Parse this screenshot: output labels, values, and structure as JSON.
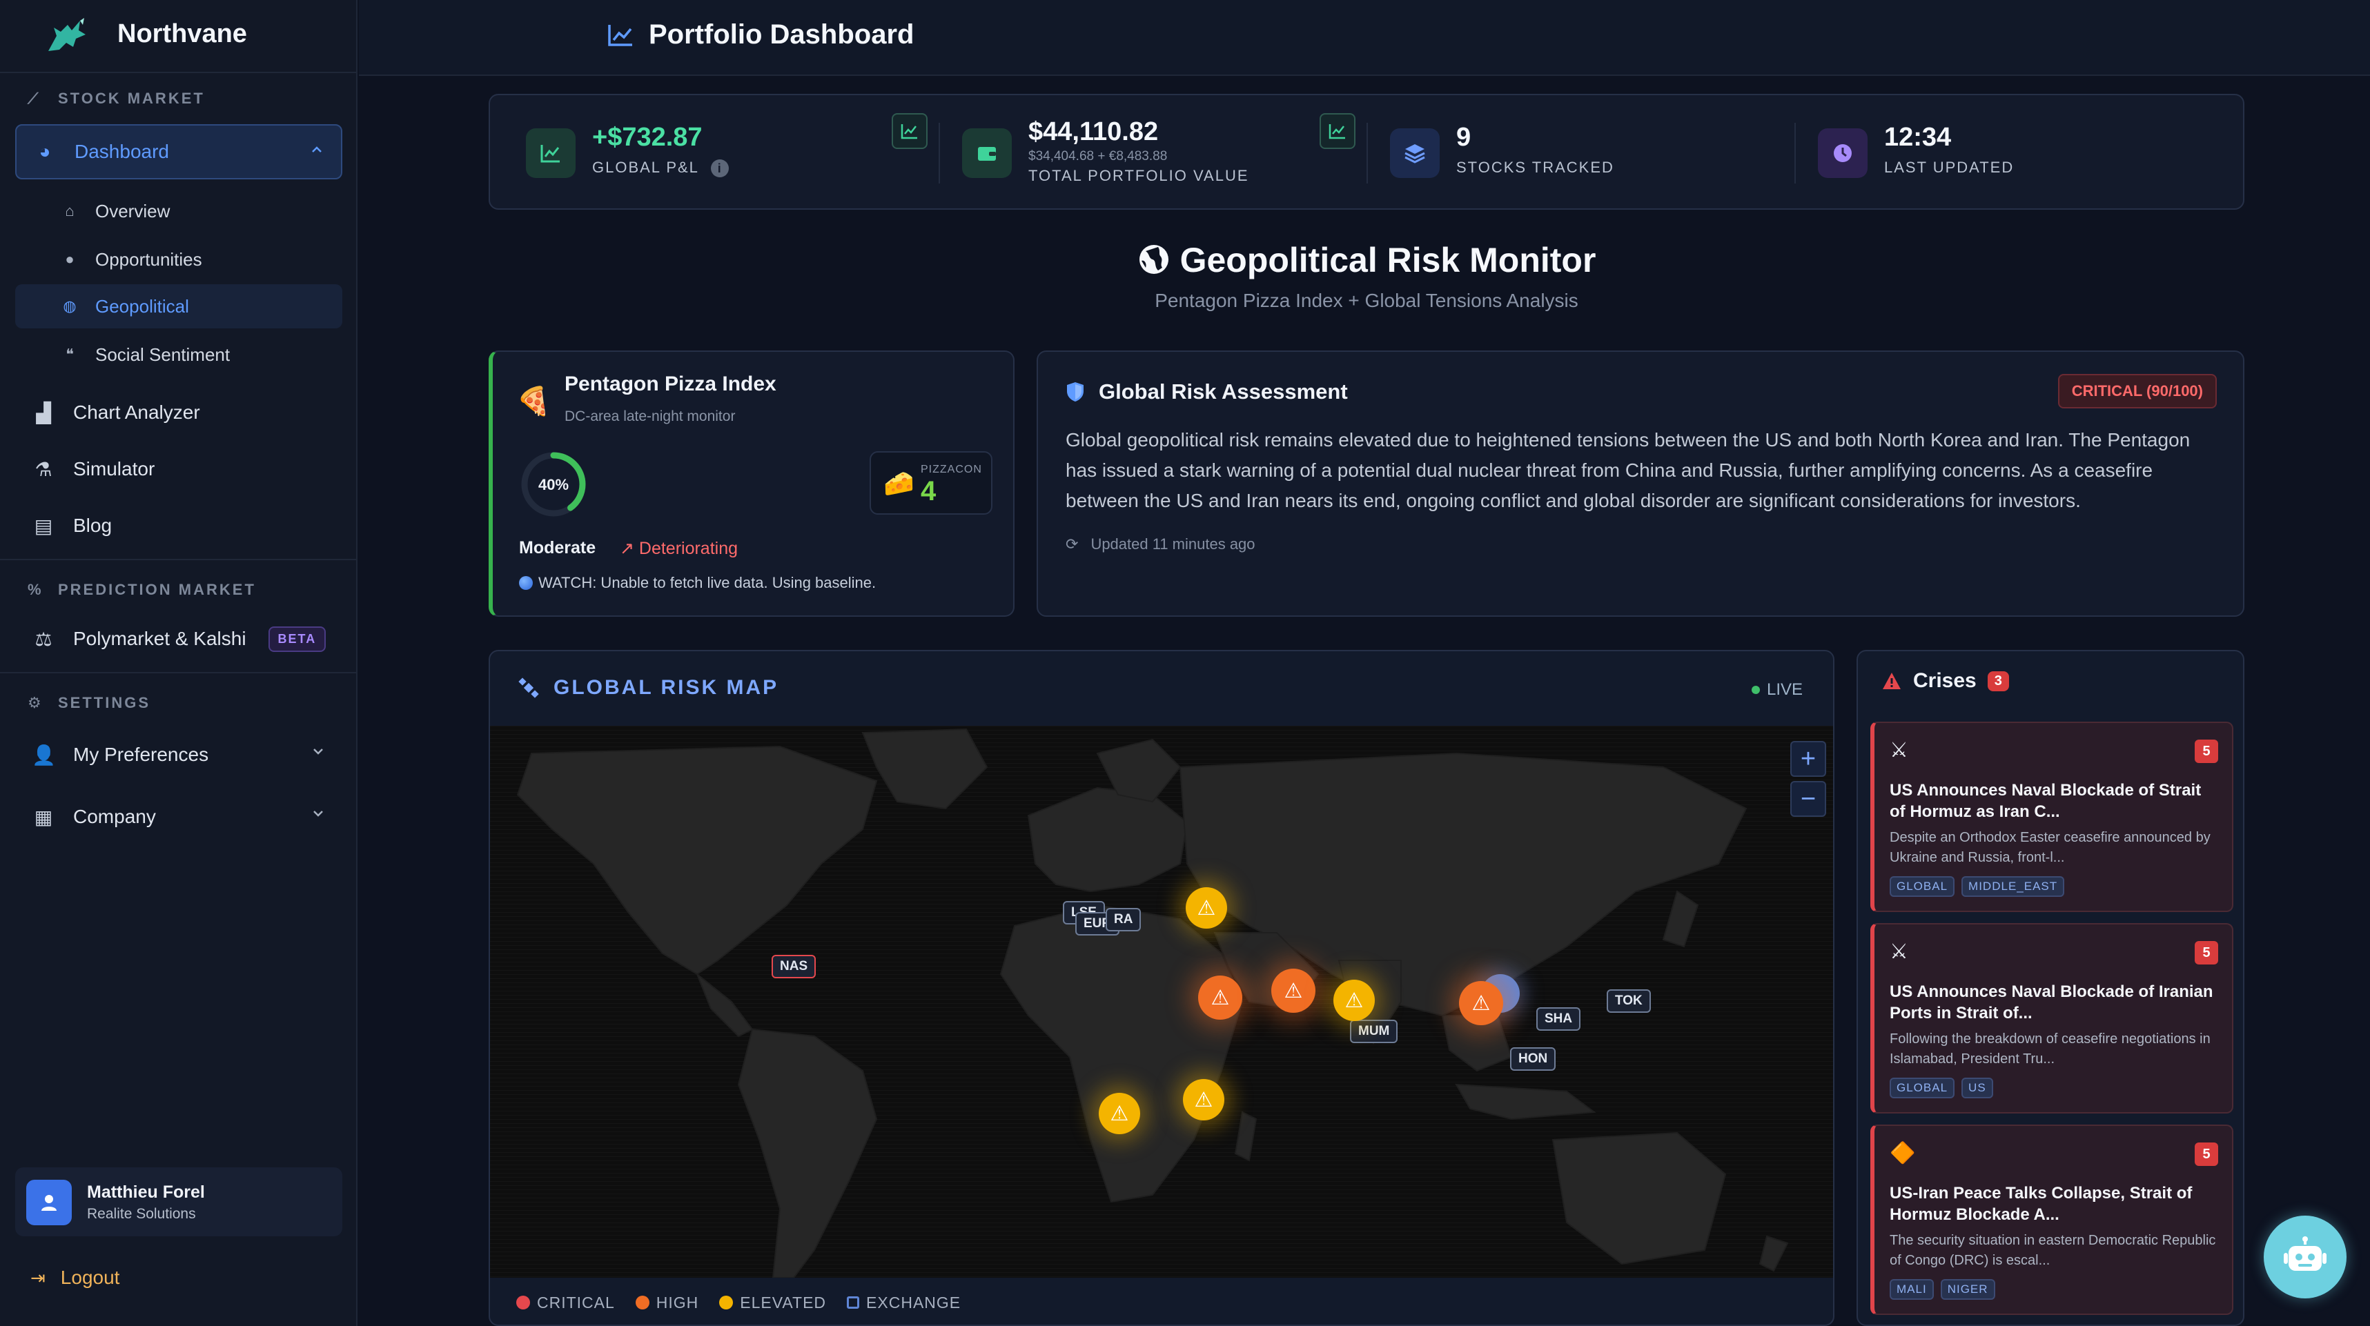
{
  "brand": {
    "name": "Northvane"
  },
  "sidebar": {
    "sections": {
      "stock": "STOCK MARKET",
      "prediction": "PREDICTION MARKET",
      "settings": "SETTINGS"
    },
    "dashboard": "Dashboard",
    "sub_items": [
      "Overview",
      "Opportunities",
      "Geopolitical",
      "Social Sentiment"
    ],
    "items": [
      "Chart Analyzer",
      "Simulator",
      "Blog"
    ],
    "polymarket": "Polymarket & Kalshi",
    "beta": "BETA",
    "preferences": "My Preferences",
    "company": "Company",
    "user": {
      "name": "Matthieu Forel",
      "company": "Realite Solutions"
    },
    "logout": "Logout"
  },
  "header": {
    "title": "Portfolio Dashboard"
  },
  "stats": {
    "pnl": {
      "value": "+$732.87",
      "label": "GLOBAL P&L"
    },
    "portfolio": {
      "value": "$44,110.82",
      "sub": "$34,404.68 + €8,483.88",
      "label": "TOTAL PORTFOLIO VALUE"
    },
    "stocks": {
      "value": "9",
      "label": "STOCKS TRACKED"
    },
    "updated": {
      "value": "12:34",
      "label": "LAST UPDATED"
    }
  },
  "hero": {
    "title": "Geopolitical Risk Monitor",
    "subtitle": "Pentagon Pizza Index + Global Tensions Analysis"
  },
  "pizza": {
    "title": "Pentagon Pizza Index",
    "subtitle": "DC-area late-night monitor",
    "percent": 40,
    "percent_label": "40%",
    "level": "Moderate",
    "trend": "↗ Deteriorating",
    "watch": "WATCH: Unable to fetch live data. Using baseline.",
    "pizzacon_label": "PIZZACON",
    "pizzacon_value": "4"
  },
  "assessment": {
    "title": "Global Risk Assessment",
    "badge": "CRITICAL (90/100)",
    "text": "Global geopolitical risk remains elevated due to heightened tensions between the US and both North Korea and Iran. The Pentagon has issued a stark warning of a potential dual nuclear threat from China and Russia, further amplifying concerns. As a ceasefire between the US and Iran nears its end, ongoing conflict and global disorder are significant considerations for investors.",
    "updated": "Updated 11 minutes ago"
  },
  "map": {
    "title": "GLOBAL RISK MAP",
    "live": "LIVE",
    "zoom_in": "+",
    "zoom_out": "−",
    "exchanges": [
      "NAS",
      "LSE",
      "EUR",
      "RA",
      "MUM",
      "SHA",
      "HON",
      "TOK"
    ],
    "legend": [
      "CRITICAL",
      "HIGH",
      "ELEVATED",
      "EXCHANGE"
    ],
    "colors": {
      "critical": "#e5484d",
      "high": "#f06d24",
      "elevated": "#f4b400",
      "exchange": "#5f86d6"
    }
  },
  "crises": {
    "title": "Crises",
    "count": "3",
    "items": [
      {
        "icon": "⚔",
        "severity": "5",
        "title": "US Announces Naval Blockade of Strait of Hormuz as Iran C...",
        "desc": "Despite an Orthodox Easter ceasefire announced by Ukraine and Russia, front-l...",
        "tags": [
          "GLOBAL",
          "MIDDLE_EAST"
        ]
      },
      {
        "icon": "⚔",
        "severity": "5",
        "title": "US Announces Naval Blockade of Iranian Ports in Strait of...",
        "desc": "Following the breakdown of ceasefire negotiations in Islamabad, President Tru...",
        "tags": [
          "GLOBAL",
          "US"
        ]
      },
      {
        "icon": "🔶",
        "severity": "5",
        "title": "US-Iran Peace Talks Collapse, Strait of Hormuz Blockade A...",
        "desc": "The security situation in eastern Democratic Republic of Congo (DRC) is escal...",
        "tags": [
          "MALI",
          "NIGER"
        ]
      }
    ]
  }
}
